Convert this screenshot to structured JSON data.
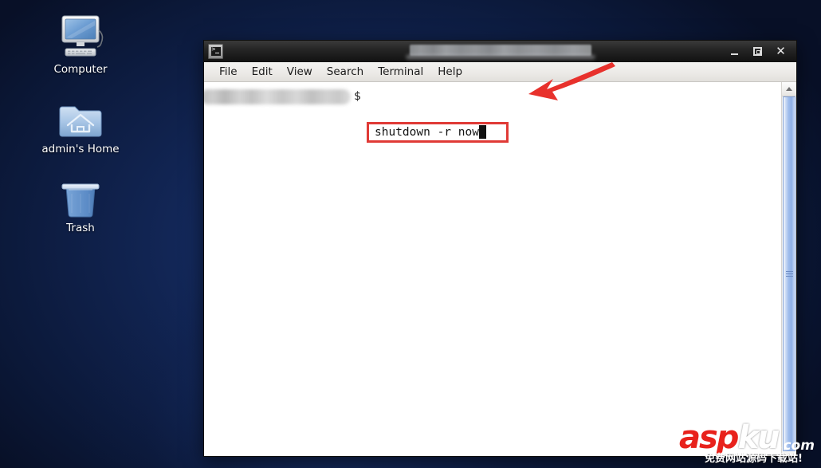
{
  "desktop": {
    "icons": [
      {
        "label": "Computer",
        "icon": "computer-monitor-icon"
      },
      {
        "label": "admin's Home",
        "icon": "home-folder-icon"
      },
      {
        "label": "Trash",
        "icon": "trash-bin-icon"
      }
    ]
  },
  "window": {
    "title": "",
    "title_redacted": true,
    "app_icon": "terminal-icon",
    "controls": {
      "minimize": "–",
      "maximize": "□",
      "close": "✕"
    },
    "menu": [
      {
        "label": "File"
      },
      {
        "label": "Edit"
      },
      {
        "label": "View"
      },
      {
        "label": "Search"
      },
      {
        "label": "Terminal"
      },
      {
        "label": "Help"
      }
    ],
    "terminal": {
      "prompt_redacted": true,
      "prompt_tail": "$",
      "command": "shutdown -r now",
      "cursor": "block",
      "highlight_color": "#e03a36"
    },
    "scrollbar": {
      "up_arrow": "scroll-up-icon",
      "thumb_color": "#9fbdec"
    }
  },
  "annotation": {
    "arrow": "red-callout-arrow",
    "arrow_color": "#e8312c"
  },
  "watermark": {
    "brand_first": "asp",
    "brand_second": "ku",
    "tld": ".com",
    "subtitle": "免费网站源码下载站!"
  }
}
